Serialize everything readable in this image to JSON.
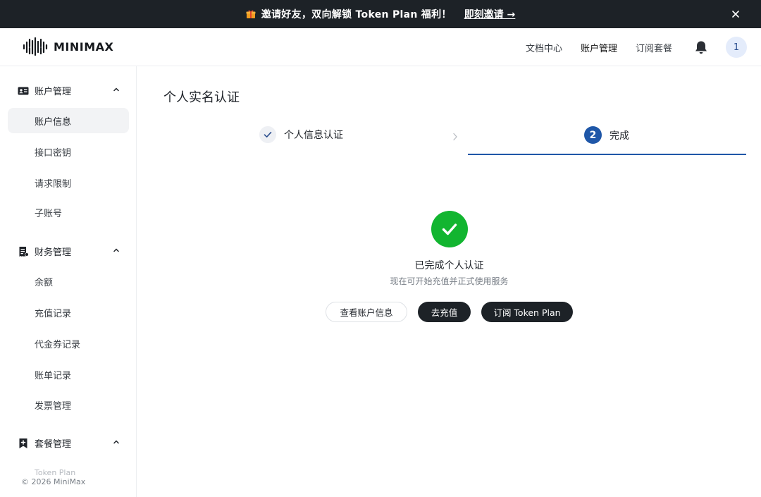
{
  "banner": {
    "text": "邀请好友，双向解锁 Token Plan 福利！",
    "link_label": "即刻邀请 →",
    "icons": [
      "gift-icon",
      "close-icon"
    ]
  },
  "header": {
    "logo_text": "MINIMAX",
    "nav": [
      {
        "label": "文档中心"
      },
      {
        "label": "账户管理"
      },
      {
        "label": "订阅套餐"
      }
    ],
    "avatar_text": "1",
    "icons": [
      "bell-icon"
    ]
  },
  "sidebar": {
    "groups": [
      {
        "label": "账户管理",
        "icon": "id-card-icon",
        "items": [
          {
            "label": "账户信息",
            "active": true
          },
          {
            "label": "接口密钥"
          },
          {
            "label": "请求限制"
          },
          {
            "label": "子账号"
          }
        ]
      },
      {
        "label": "财务管理",
        "icon": "receipt-icon",
        "items": [
          {
            "label": "余额"
          },
          {
            "label": "充值记录"
          },
          {
            "label": "代金券记录"
          },
          {
            "label": "账单记录"
          },
          {
            "label": "发票管理"
          }
        ]
      },
      {
        "label": "套餐管理",
        "icon": "bookmark-plus-icon",
        "items": [
          {
            "label": "Token Plan"
          }
        ]
      }
    ],
    "copyright": "© 2026 MiniMax"
  },
  "main": {
    "title": "个人实名认证",
    "steps": [
      {
        "label": "个人信息认证",
        "state": "done"
      },
      {
        "number": "2",
        "label": "完成",
        "state": "active"
      }
    ],
    "success": {
      "title": "已完成个人认证",
      "subtitle": "现在可开始充值并正式使用服务"
    },
    "buttons": [
      {
        "label": "查看账户信息"
      },
      {
        "label": "去充值"
      },
      {
        "label": "订阅 Token Plan"
      }
    ]
  },
  "colors": {
    "banner_bg": "#1d2227",
    "accent_blue": "#1f57a8",
    "success_green": "#12b530",
    "dark_button": "#1d2227"
  }
}
